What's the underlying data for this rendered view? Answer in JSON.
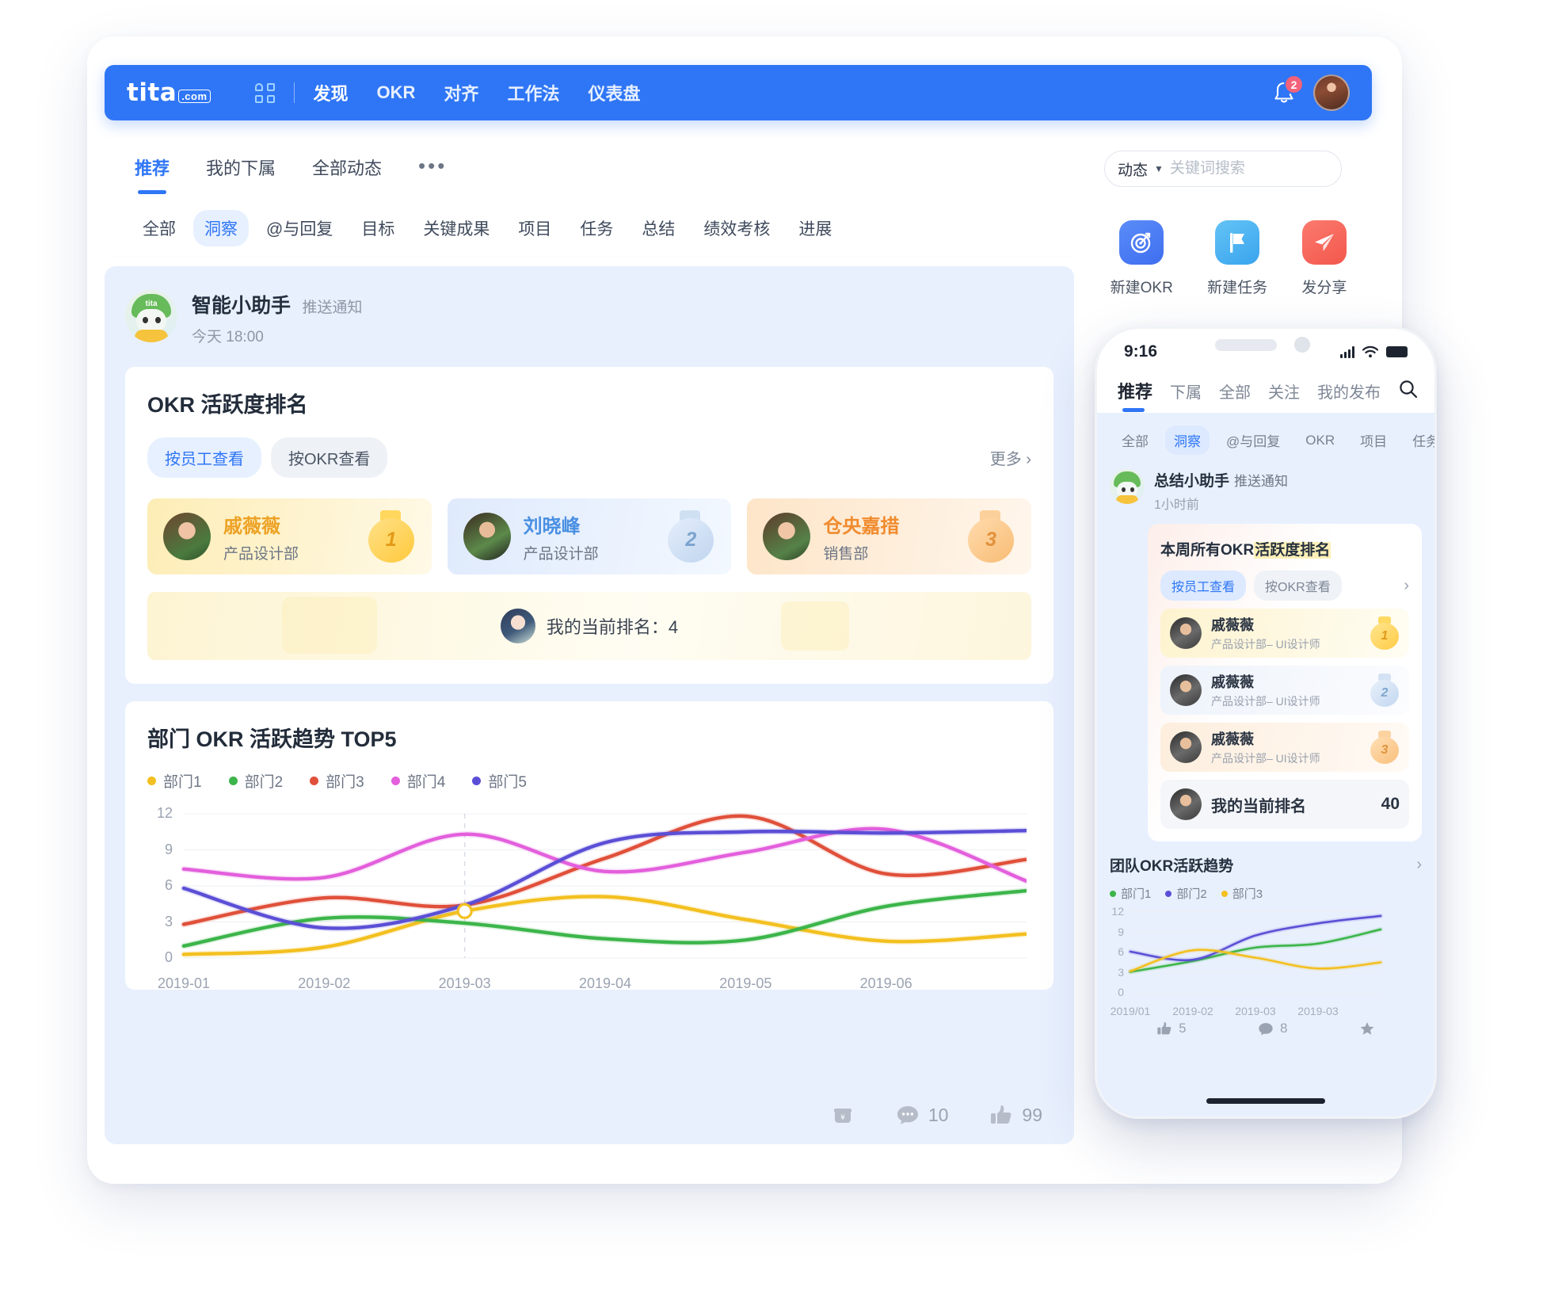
{
  "navbar": {
    "logo": "tita",
    "logo_suffix": ".com",
    "grid_icon": "grid-apps-icon",
    "items": [
      {
        "label": "发现",
        "active": true
      },
      {
        "label": "OKR",
        "active": false
      },
      {
        "label": "对齐",
        "active": false
      },
      {
        "label": "工作法",
        "active": false
      },
      {
        "label": "仪表盘",
        "active": false
      }
    ],
    "bell_icon": "bell-icon",
    "notification_count": "2",
    "avatar": "user-avatar",
    "bg_color": "#2f76f6"
  },
  "tabs": [
    {
      "label": "推荐",
      "active": true
    },
    {
      "label": "我的下属",
      "active": false
    },
    {
      "label": "全部动态",
      "active": false
    }
  ],
  "tab_more": "•••",
  "search": {
    "scope": "动态",
    "caret": "▼",
    "placeholder": "关键词搜索",
    "value": ""
  },
  "chips": [
    {
      "label": "全部",
      "active": false
    },
    {
      "label": "洞察",
      "active": true
    },
    {
      "label": "@与回复",
      "active": false
    },
    {
      "label": "目标",
      "active": false
    },
    {
      "label": "关键成果",
      "active": false
    },
    {
      "label": "项目",
      "active": false
    },
    {
      "label": "任务",
      "active": false
    },
    {
      "label": "总结",
      "active": false
    },
    {
      "label": "绩效考核",
      "active": false
    },
    {
      "label": "进展",
      "active": false
    }
  ],
  "post": {
    "author": "智能小助手",
    "author_tag": "推送通知",
    "time": "今天 18:00",
    "avatar": "bot-avatar"
  },
  "rank_card": {
    "title": "OKR 活跃度排名",
    "seg_active": "按员工查看",
    "seg_inactive": "按OKR查看",
    "more": "更多 ›",
    "podium": [
      {
        "name": "戚薇薇",
        "dept": "产品设计部",
        "medal": "1"
      },
      {
        "name": "刘晓峰",
        "dept": "产品设计部",
        "medal": "2"
      },
      {
        "name": "仓央嘉措",
        "dept": "销售部",
        "medal": "3"
      }
    ],
    "my_rank_label": "我的当前排名：4"
  },
  "chart_card": {
    "title": "部门 OKR 活跃趋势 TOP5"
  },
  "chart_data": {
    "type": "line",
    "title": "部门 OKR 活跃趋势 TOP5",
    "xlabel": "",
    "ylabel": "",
    "x": [
      "2019-01",
      "2019-02",
      "2019-03",
      "2019-04",
      "2019-05",
      "2019-06"
    ],
    "yticks": [
      0,
      3,
      6,
      9,
      12
    ],
    "ylim": [
      0,
      12
    ],
    "grid": true,
    "legend_position": "top-left",
    "highlight": {
      "x": "2019-03",
      "series": "部门1",
      "value": 3.9
    },
    "series": [
      {
        "name": "部门1",
        "color": "#f3c020",
        "values": [
          0.3,
          0.9,
          3.9,
          5.1,
          3.2,
          1.4,
          2.0
        ]
      },
      {
        "name": "部门2",
        "color": "#3cb54a",
        "values": [
          1.0,
          3.3,
          2.9,
          1.6,
          1.5,
          4.3,
          5.6
        ]
      },
      {
        "name": "部门3",
        "color": "#e0503a",
        "values": [
          2.8,
          5.0,
          4.4,
          8.3,
          11.8,
          7.0,
          8.2
        ]
      },
      {
        "name": "部门4",
        "color": "#e35fdc",
        "values": [
          7.4,
          6.7,
          10.3,
          7.2,
          8.8,
          10.7,
          6.4
        ]
      },
      {
        "name": "部门5",
        "color": "#5b4fd6",
        "values": [
          5.8,
          2.5,
          4.4,
          9.6,
          10.5,
          10.4,
          10.6
        ]
      }
    ]
  },
  "post_actions": [
    {
      "icon": "reward-icon",
      "count": ""
    },
    {
      "icon": "comment-icon",
      "count": "10"
    },
    {
      "icon": "thumbs-up-icon",
      "count": "99"
    }
  ],
  "quick_actions": [
    {
      "label": "新建OKR",
      "icon": "target-icon",
      "color": "#3f6ef0"
    },
    {
      "label": "新建任务",
      "icon": "flag-icon",
      "color": "#3aa4ee"
    },
    {
      "label": "发分享",
      "icon": "paper-plane-icon",
      "color": "#f3574c"
    }
  ],
  "phone": {
    "status": {
      "clock": "9:16",
      "signal_icon": "signal-bars-icon",
      "wifi_icon": "wifi-icon",
      "battery_icon": "battery-icon"
    },
    "tabs": [
      {
        "label": "推荐",
        "active": true
      },
      {
        "label": "下属",
        "active": false
      },
      {
        "label": "全部",
        "active": false
      },
      {
        "label": "关注",
        "active": false
      },
      {
        "label": "我的发布",
        "active": false
      }
    ],
    "search_icon": "search-icon",
    "chips": [
      {
        "label": "全部",
        "active": false
      },
      {
        "label": "洞察",
        "active": true
      },
      {
        "label": "@与回复",
        "active": false
      },
      {
        "label": "OKR",
        "active": false
      },
      {
        "label": "项目",
        "active": false
      },
      {
        "label": "任务",
        "active": false
      }
    ],
    "post": {
      "author": "总结小助手",
      "author_tag": "推送通知",
      "time": "1小时前"
    },
    "card": {
      "title_plain": "本周所有OKR",
      "title_highlight": "活跃度排名",
      "seg_active": "按员工查看",
      "seg_inactive": "按OKR查看",
      "chevron": "›",
      "rows": [
        {
          "name": "戚薇薇",
          "dept": "产品设计部– UI设计师",
          "medal": "1"
        },
        {
          "name": "戚薇薇",
          "dept": "产品设计部– UI设计师",
          "medal": "2"
        },
        {
          "name": "戚薇薇",
          "dept": "产品设计部– UI设计师",
          "medal": "3"
        }
      ],
      "my_rank_label": "我的当前排名",
      "my_rank_value": "40"
    },
    "trend": {
      "title": "团队OKR活跃趋势",
      "chevron": "›"
    },
    "trend_chart": {
      "type": "line",
      "title": "团队OKR活跃趋势",
      "x": [
        "2019/01",
        "2019-02",
        "2019-03",
        "2019-03"
      ],
      "yticks": [
        0,
        3,
        6,
        9,
        12
      ],
      "ylim": [
        0,
        12
      ],
      "grid": true,
      "series": [
        {
          "name": "部门1",
          "color": "#3cb54a",
          "values": [
            3.0,
            4.6,
            6.6,
            7.2,
            9.3
          ]
        },
        {
          "name": "部门2",
          "color": "#5b4fd6",
          "values": [
            6.0,
            4.8,
            8.4,
            10.2,
            11.3
          ]
        },
        {
          "name": "部门3",
          "color": "#f3c020",
          "values": [
            3.1,
            6.2,
            5.1,
            3.5,
            4.4
          ]
        }
      ]
    },
    "actions": [
      {
        "icon": "thumbs-up-icon",
        "count": "5"
      },
      {
        "icon": "comment-icon",
        "count": "8"
      },
      {
        "icon": "star-icon",
        "count": ""
      }
    ]
  }
}
